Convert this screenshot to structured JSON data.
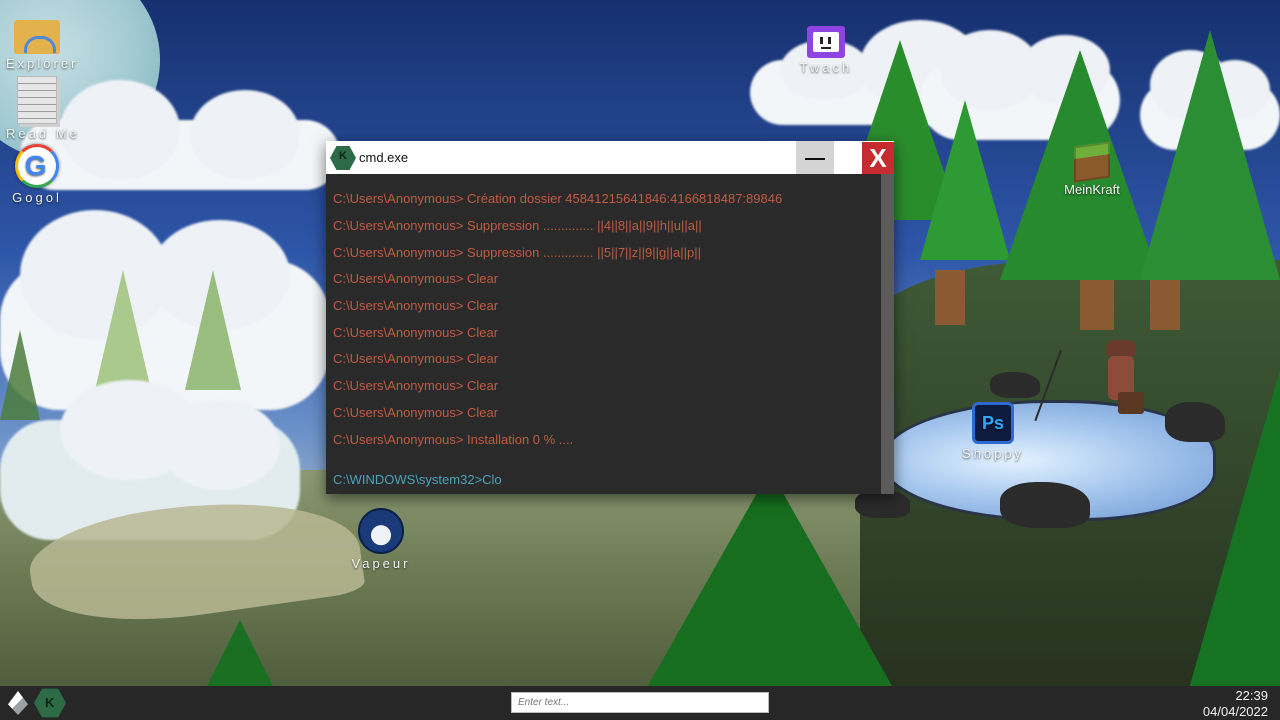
{
  "desktop": {
    "icons": {
      "explorer": "Explorer",
      "readme": "Read Me",
      "gogol": "Gogol",
      "twach": "Twach",
      "meinkraft": "MeinKraft",
      "shoppy": "Shoppy",
      "vapeur": "Vapeur"
    },
    "shoppy_glyph": "Ps",
    "gogol_glyph": "G"
  },
  "cmd": {
    "title": "cmd.exe",
    "close_glyph": "X",
    "log": [
      "C:\\Users\\Anonymous> Création dossier 45841215641846:4166818487:89846",
      "C:\\Users\\Anonymous> Suppression .............. ||4||8||a||9||h||u||a||",
      "C:\\Users\\Anonymous> Suppression .............. ||5||7||z||9||g||a||p||",
      "C:\\Users\\Anonymous> Clear",
      "C:\\Users\\Anonymous> Clear",
      "C:\\Users\\Anonymous> Clear",
      "C:\\Users\\Anonymous> Clear",
      "C:\\Users\\Anonymous> Clear",
      "C:\\Users\\Anonymous> Clear",
      "C:\\Users\\Anonymous> Installation 0 % ...."
    ],
    "prompt": "C:\\WINDOWS\\system32>Clo",
    "colors": {
      "log": "#c05b43",
      "prompt": "#4aa3bc",
      "close": "#c62b2f"
    }
  },
  "taskbar": {
    "search_placeholder": "Enter text...",
    "time": "22:39",
    "date": "04/04/2022"
  }
}
